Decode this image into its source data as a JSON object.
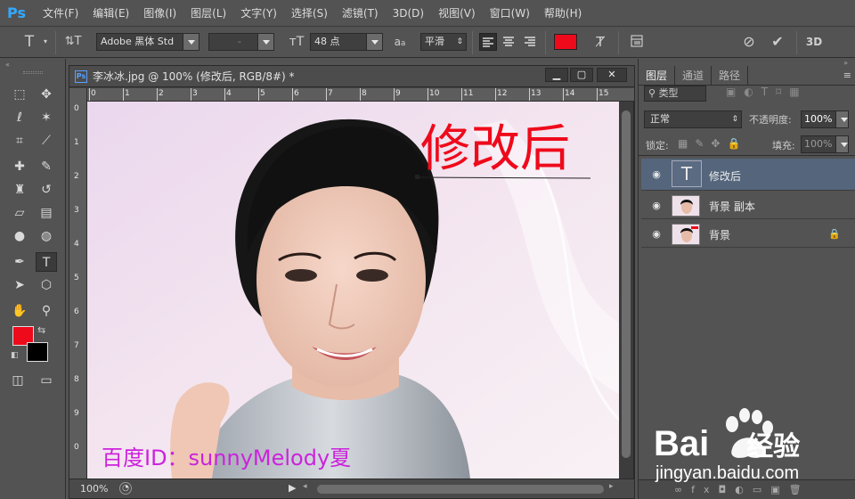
{
  "app": {
    "logo": "Ps",
    "menu": [
      "文件(F)",
      "编辑(E)",
      "图像(I)",
      "图层(L)",
      "文字(Y)",
      "选择(S)",
      "滤镜(T)",
      "3D(D)",
      "视图(V)",
      "窗口(W)",
      "帮助(H)"
    ]
  },
  "options": {
    "font_family": "Adobe 黑体 Std",
    "font_style": "-",
    "font_size": "48 点",
    "aa_label": "a",
    "antialias": "平滑",
    "text_color": "#ee0a1b"
  },
  "document": {
    "tab_icon": "Ps",
    "title": "李冰冰.jpg @ 100% (修改后, RGB/8#) *",
    "ruler_h": [
      "0",
      "1",
      "2",
      "3",
      "4",
      "5",
      "6",
      "7",
      "8",
      "9",
      "10",
      "11",
      "12",
      "13",
      "14",
      "15"
    ],
    "ruler_v": [
      "0",
      "1",
      "2",
      "3",
      "4",
      "5",
      "6",
      "7",
      "8",
      "9",
      "0"
    ],
    "canvas_text": "修改后",
    "watermark": "百度ID：sunnyMelody夏",
    "zoom": "100%"
  },
  "panel": {
    "tabs": [
      "图层",
      "通道",
      "路径"
    ],
    "filter_kind": "类型",
    "blend_mode": "正常",
    "opacity_label": "不透明度:",
    "opacity_value": "100%",
    "lock_label": "锁定:",
    "fill_label": "填充:",
    "fill_value": "100%",
    "layers": [
      {
        "name": "修改后",
        "type": "text",
        "selected": true
      },
      {
        "name": "背景 副本",
        "type": "image",
        "selected": false
      },
      {
        "name": "背景",
        "type": "image",
        "selected": false,
        "locked": true
      }
    ]
  },
  "branding": {
    "baidu_logo": "Bai",
    "baidu_logo2": "经验",
    "baidu_url": "jingyan.baidu.com"
  }
}
